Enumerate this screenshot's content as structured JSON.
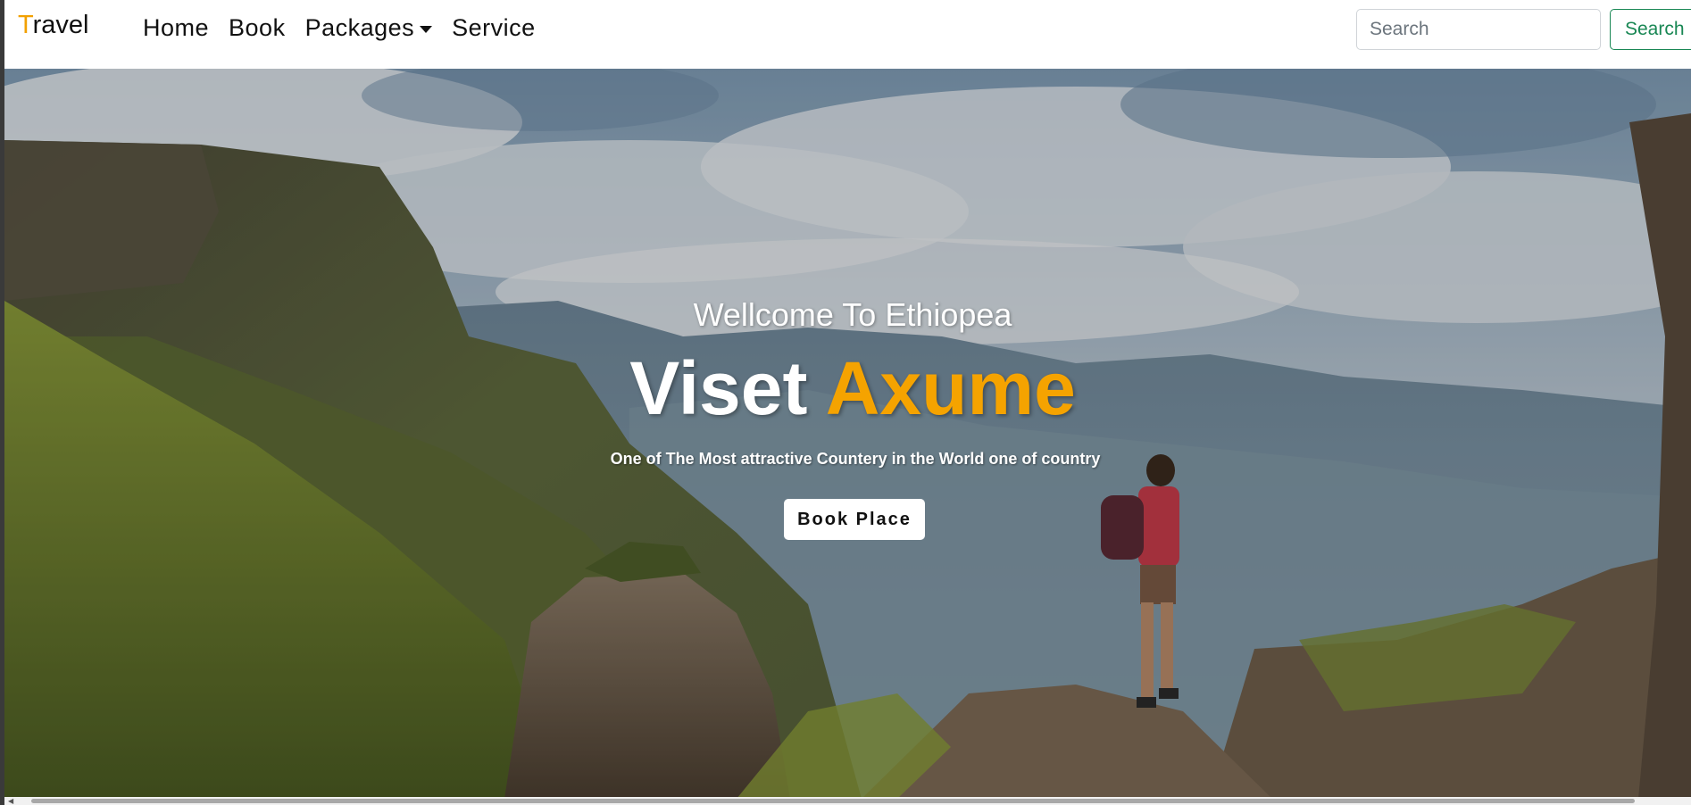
{
  "navbar": {
    "brand_first": "T",
    "brand_rest": "ravel",
    "links": [
      {
        "label": "Home"
      },
      {
        "label": "Book"
      },
      {
        "label": "Packages"
      },
      {
        "label": "Service"
      }
    ],
    "search_placeholder": "Search",
    "search_button": "Search"
  },
  "hero": {
    "welcome": "Wellcome To Ethiopea",
    "headline_white": "Viset",
    "headline_accent": "Axume",
    "tagline": "One of The Most attractive Countery in the World one of country",
    "cta": "Book Place"
  },
  "colors": {
    "accent": "#f5a300",
    "search_button": "#198754",
    "text_dark": "#111111"
  },
  "icons": {
    "dropdown": "chevron-down-icon"
  }
}
